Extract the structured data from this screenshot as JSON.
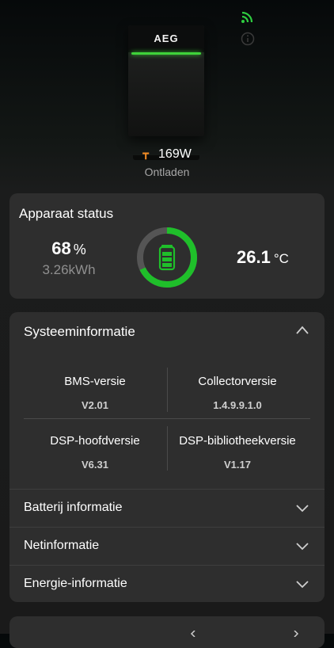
{
  "device": {
    "brand_logo": "AEG"
  },
  "header_icons": {
    "wifi": "wifi-signal-icon",
    "info": "info-icon"
  },
  "power": {
    "value": "169W",
    "mode": "Ontladen",
    "icon": "discharge-icon"
  },
  "status": {
    "title": "Apparaat status",
    "soc_value": "68",
    "soc_unit": "%",
    "soc_fraction": 0.68,
    "energy": "3.26kWh",
    "temperature_value": "26.1",
    "temperature_unit": "°C",
    "colors": {
      "ring": "#1fbf2a",
      "ring_track": "#555555",
      "battery": "#1fbf2a"
    }
  },
  "system_info": {
    "title": "Systeeminformatie",
    "expanded": true,
    "items": [
      {
        "label": "BMS-versie",
        "value": "V2.01"
      },
      {
        "label": "Collectorversie",
        "value": "1.4.9.9.1.0"
      },
      {
        "label": "DSP-hoofdversie",
        "value": "V6.31"
      },
      {
        "label": "DSP-bibliotheekversie",
        "value": "V1.17"
      }
    ]
  },
  "sections": [
    {
      "label": "Batterij informatie"
    },
    {
      "label": "Netinformatie"
    },
    {
      "label": "Energie-informatie"
    }
  ]
}
